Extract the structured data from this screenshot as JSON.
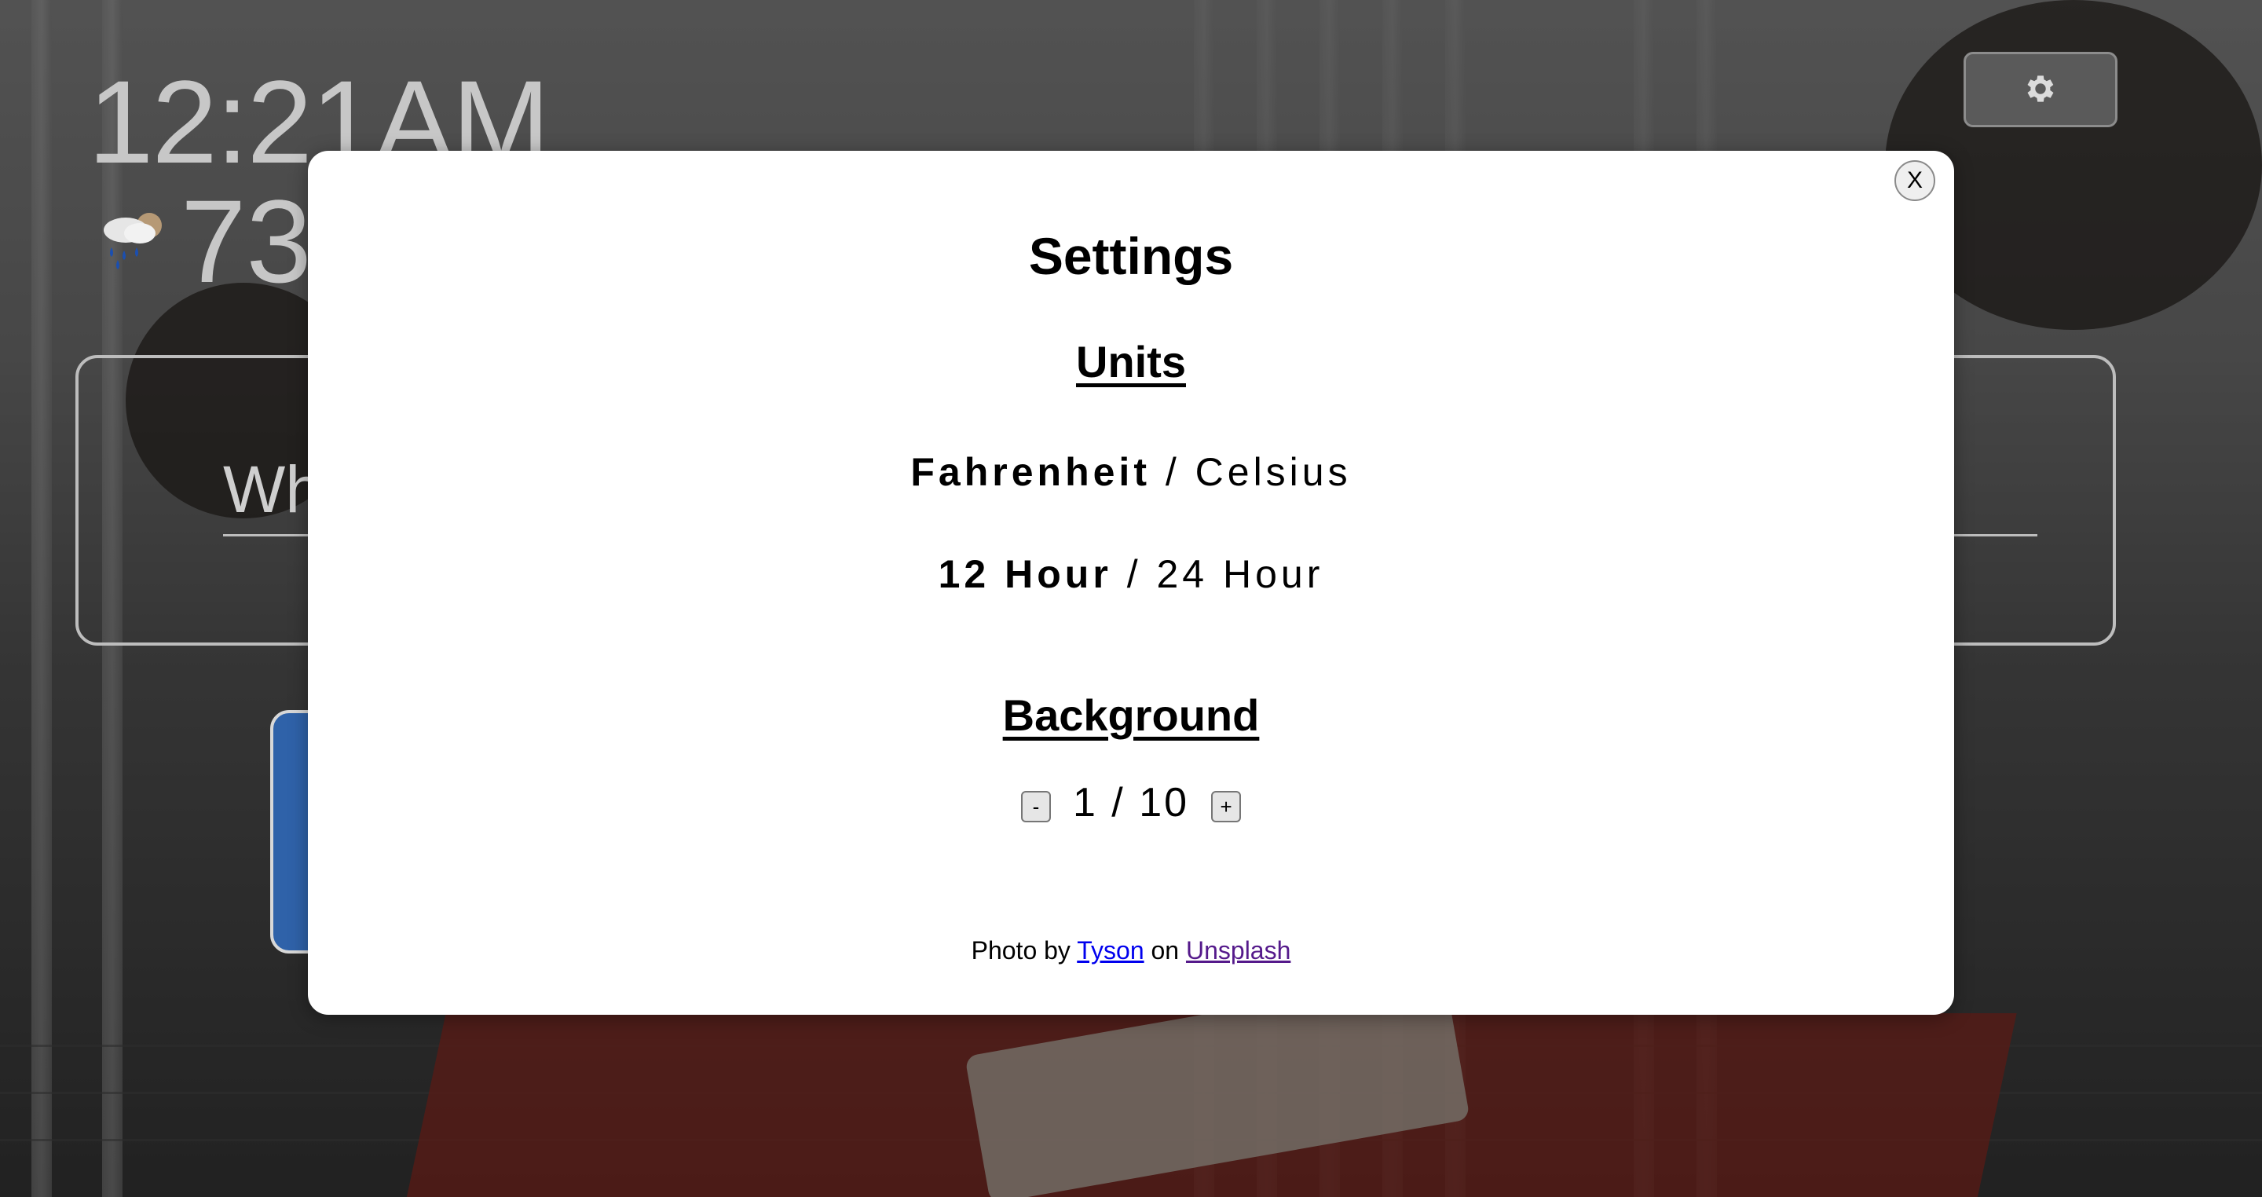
{
  "dashboard": {
    "clock": "12:21AM",
    "temperature": "73",
    "weather_icon": "rain-cloud-icon",
    "settings_icon": "gear-icon",
    "search_placeholder": "Wh"
  },
  "modal": {
    "close_label": "X",
    "title": "Settings",
    "units_heading": "Units",
    "temperature_units": {
      "active": "Fahrenheit",
      "separator": " / ",
      "inactive": "Celsius"
    },
    "time_format": {
      "active": "12 Hour",
      "separator": " / ",
      "inactive": "24 Hour"
    },
    "background_heading": "Background",
    "background_stepper": {
      "decrement_label": "-",
      "increment_label": "+",
      "value": "1 / 10"
    },
    "credit": {
      "prefix": "Photo by ",
      "author": "Tyson",
      "middle": " on ",
      "site": "Unsplash"
    }
  },
  "colors": {
    "overlay": "#000000",
    "link": "#0000ee",
    "visited_link": "#551a8b",
    "blue_panel": "#2f62a9"
  }
}
